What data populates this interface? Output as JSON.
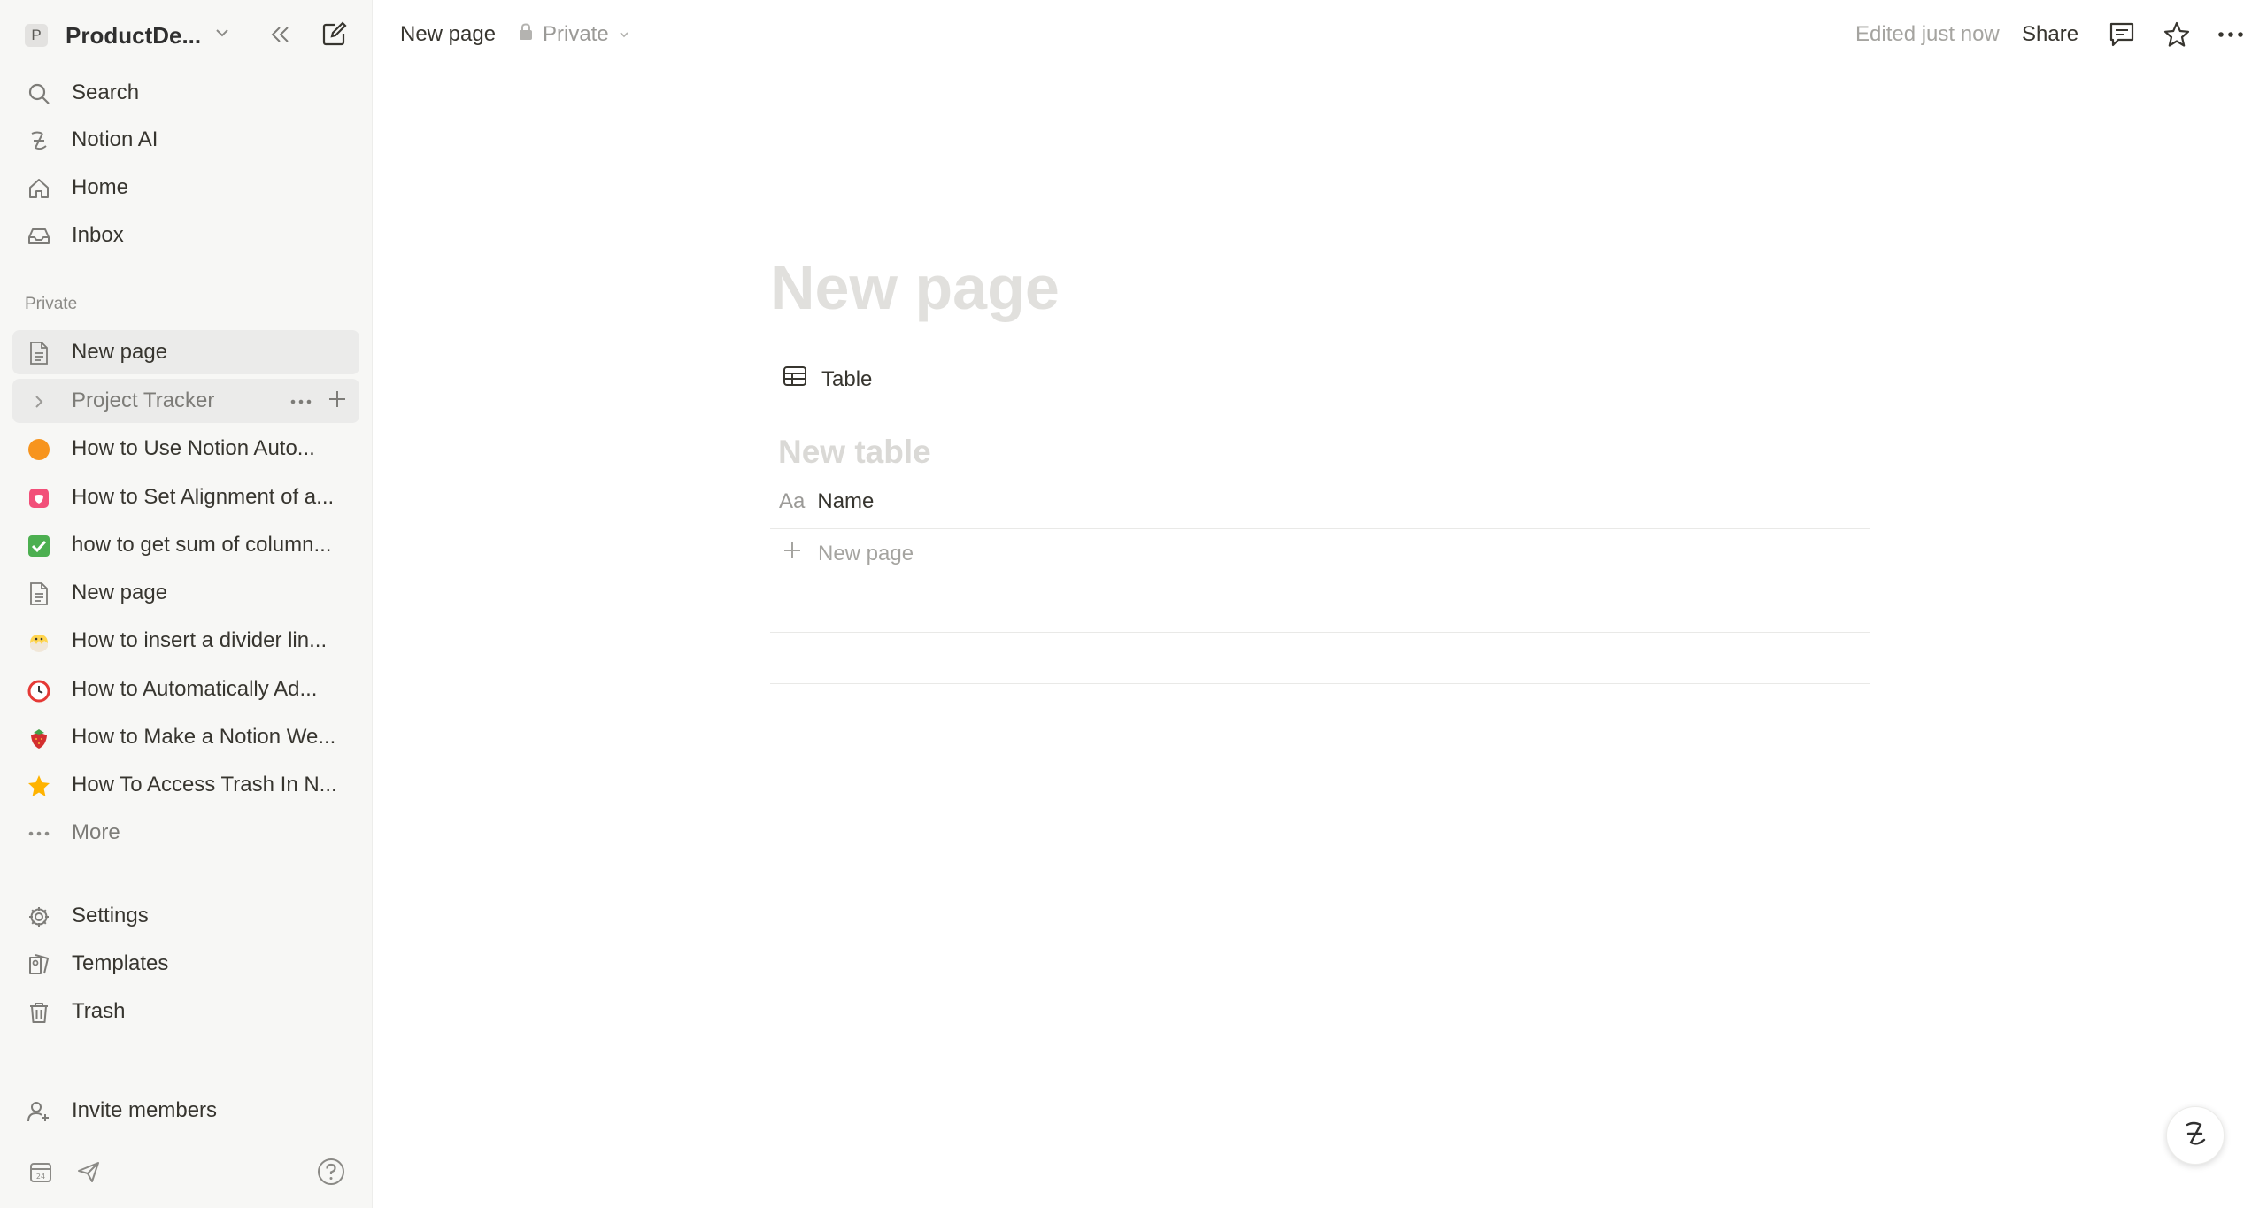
{
  "sidebar": {
    "workspace": {
      "initial": "P",
      "name": "ProductDe..."
    },
    "top_nav": [
      {
        "label": "Search",
        "icon": "search-icon"
      },
      {
        "label": "Notion AI",
        "icon": "notion-ai-icon"
      },
      {
        "label": "Home",
        "icon": "home-icon"
      },
      {
        "label": "Inbox",
        "icon": "inbox-icon"
      }
    ],
    "section_label": "Private",
    "pages": [
      {
        "label": "New page",
        "icon": "page-icon",
        "active": true
      },
      {
        "label": "Project Tracker",
        "icon": "chevron-right-icon",
        "hovered": true
      },
      {
        "label": "How to Use Notion Auto...",
        "icon": "orange-circle-emoji",
        "emoji": "🟠"
      },
      {
        "label": "How to Set Alignment of a...",
        "icon": "pink-emoji",
        "emoji": "💟"
      },
      {
        "label": "how to get sum of column...",
        "icon": "check-mark-emoji",
        "emoji": "✅"
      },
      {
        "label": "New page",
        "icon": "page-icon"
      },
      {
        "label": "How to insert a divider lin...",
        "icon": "chick-emoji",
        "emoji": "🐣"
      },
      {
        "label": "How to Automatically Ad...",
        "icon": "alarm-clock-emoji",
        "emoji": "⏰"
      },
      {
        "label": "How to Make a Notion We...",
        "icon": "strawberry-emoji",
        "emoji": "🍓"
      },
      {
        "label": "How To Access Trash In N...",
        "icon": "star-emoji",
        "emoji": "🌟"
      }
    ],
    "more_label": "More",
    "bottom_nav": [
      {
        "label": "Settings",
        "icon": "gear-icon"
      },
      {
        "label": "Templates",
        "icon": "templates-icon"
      },
      {
        "label": "Trash",
        "icon": "trash-icon"
      }
    ],
    "invite_label": "Invite members"
  },
  "topbar": {
    "title": "New page",
    "privacy": "Private",
    "edited": "Edited just now",
    "share": "Share"
  },
  "main": {
    "page_title_placeholder": "New page",
    "view_tab": "Table",
    "table_title_placeholder": "New table",
    "column_type": "Aa",
    "column_name": "Name",
    "new_row_label": "New page"
  },
  "colors": {
    "sidebar_bg": "#f7f7f5",
    "text": "#37352f",
    "muted": "#9b9a97",
    "placeholder": "#e1e0dd"
  }
}
